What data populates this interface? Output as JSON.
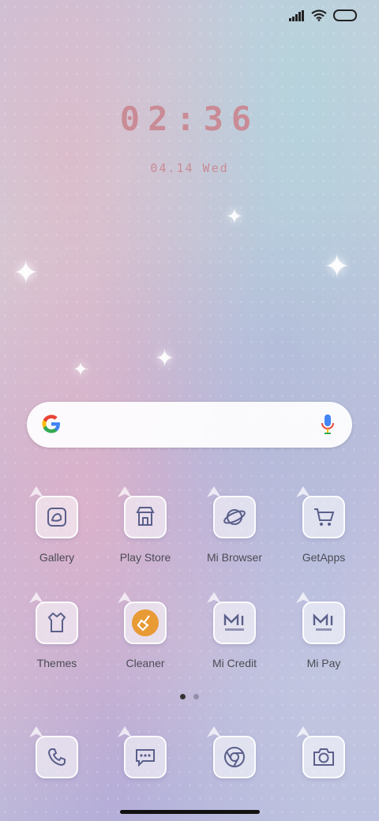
{
  "status_bar": {
    "signal_icon": "signal-bars-icon",
    "wifi_icon": "wifi-icon",
    "battery_icon": "battery-icon"
  },
  "clock": {
    "time": "02:36",
    "date": "04.14 Wed"
  },
  "search_bar": {
    "google_icon": "google-g-icon",
    "mic_icon": "microphone-icon"
  },
  "apps_row1": [
    {
      "label": "Gallery",
      "icon": "gallery-icon"
    },
    {
      "label": "Play Store",
      "icon": "play-store-icon"
    },
    {
      "label": "Mi Browser",
      "icon": "planet-icon"
    },
    {
      "label": "GetApps",
      "icon": "shopping-cart-icon"
    }
  ],
  "apps_row2": [
    {
      "label": "Themes",
      "icon": "dress-icon"
    },
    {
      "label": "Cleaner",
      "icon": "broom-icon"
    },
    {
      "label": "Mi Credit",
      "icon": "mi-credit-icon"
    },
    {
      "label": "Mi Pay",
      "icon": "mi-pay-icon"
    }
  ],
  "dock": [
    {
      "icon": "phone-icon"
    },
    {
      "icon": "messages-icon"
    },
    {
      "icon": "chrome-icon"
    },
    {
      "icon": "camera-icon"
    }
  ],
  "pager": {
    "pages": 2,
    "active": 1
  },
  "colors": {
    "clock": "#c98b95",
    "label": "#4b4b55",
    "cleaner_orange": "#e89a35"
  }
}
